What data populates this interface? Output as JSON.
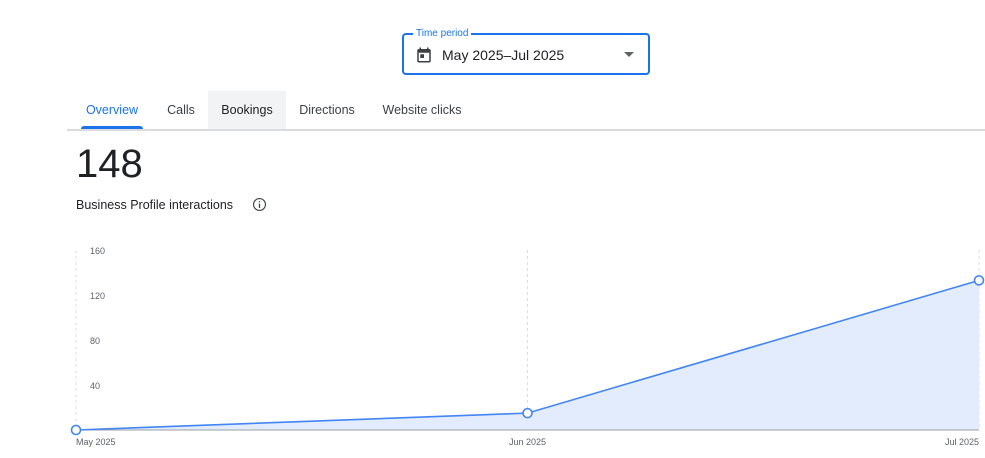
{
  "period": {
    "label": "Time period",
    "value": "May 2025–Jul 2025"
  },
  "tabs": [
    {
      "label": "Overview",
      "state": "selected"
    },
    {
      "label": "Calls",
      "state": "normal"
    },
    {
      "label": "Bookings",
      "state": "hovered"
    },
    {
      "label": "Directions",
      "state": "normal"
    },
    {
      "label": "Website clicks",
      "state": "normal"
    }
  ],
  "metric": {
    "value": "148",
    "label": "Business Profile interactions"
  },
  "icons": {
    "calendar": "calendar-icon",
    "dropdown": "dropdown-arrow-icon",
    "info": "info-icon"
  },
  "colors": {
    "accent": "#1a73e8",
    "line": "#4285f4",
    "area_fill": "#e3ecfc",
    "divider": "#dadce0"
  },
  "chart_data": {
    "type": "area",
    "categories": [
      "May 2025",
      "Jun 2025",
      "Jul 2025"
    ],
    "values": [
      0,
      15,
      133
    ],
    "yticks": [
      40,
      80,
      120,
      160
    ],
    "ylim": [
      0,
      160
    ],
    "grid": true,
    "series": [
      {
        "values": [
          0,
          15,
          133
        ]
      }
    ]
  }
}
